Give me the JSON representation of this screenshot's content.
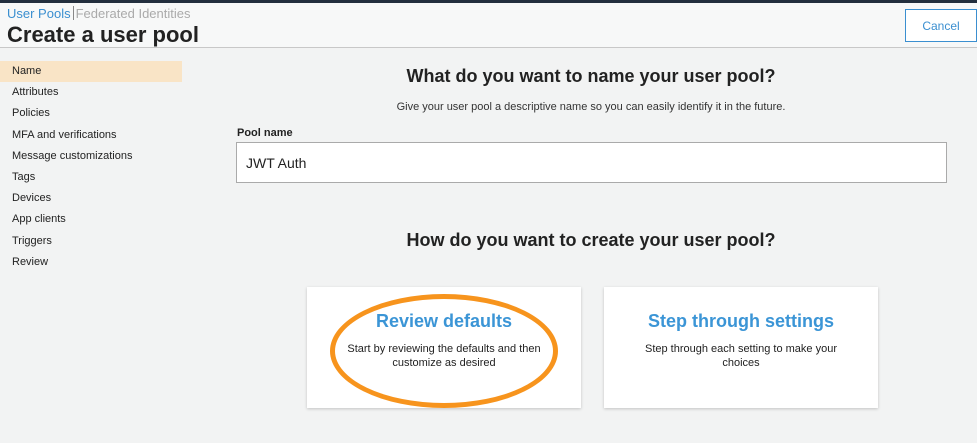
{
  "breadcrumb": {
    "user_pools": "User Pools",
    "federated": "Federated Identities"
  },
  "page_title": "Create a user pool",
  "cancel_label": "Cancel",
  "nav": [
    "Name",
    "Attributes",
    "Policies",
    "MFA and verifications",
    "Message customizations",
    "Tags",
    "Devices",
    "App clients",
    "Triggers",
    "Review"
  ],
  "name_section": {
    "heading": "What do you want to name your user pool?",
    "description": "Give your user pool a descriptive name so you can easily identify it in the future.",
    "label": "Pool name",
    "value": "JWT Auth"
  },
  "create_section": {
    "heading": "How do you want to create your user pool?",
    "options": [
      {
        "title": "Review defaults",
        "description": "Start by reviewing the defaults and then customize as desired"
      },
      {
        "title": "Step through settings",
        "description": "Step through each setting to make your choices"
      }
    ]
  },
  "colors": {
    "accent": "#3b95d6",
    "highlight": "#f7941d",
    "active_nav": "#f9e4c6"
  }
}
